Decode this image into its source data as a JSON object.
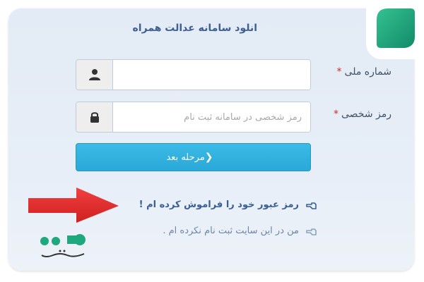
{
  "header": {
    "title": "انلود سامانه عدالت همراه"
  },
  "form": {
    "national_id": {
      "label": "شماره ملی",
      "required_mark": "*",
      "value": "",
      "placeholder": "",
      "icon": "user-icon"
    },
    "password": {
      "label": "رمز شخصی",
      "required_mark": "*",
      "value": "",
      "placeholder": "رمز شخصی در سامانه ثبت نام",
      "icon": "lock-icon"
    },
    "next_button": {
      "label": "مرحله بعد",
      "chevron": "❮"
    }
  },
  "links": {
    "forgot_password": "رمز عبور خود را فراموش کرده ام !",
    "not_registered": "من در این سایت ثبت نام نکرده ام ."
  },
  "colors": {
    "accent": "#2aa8d9",
    "title": "#3f5f91",
    "required": "#d42a2a",
    "arrow": "#e52b2b",
    "brand_green": "#1fa77f"
  }
}
